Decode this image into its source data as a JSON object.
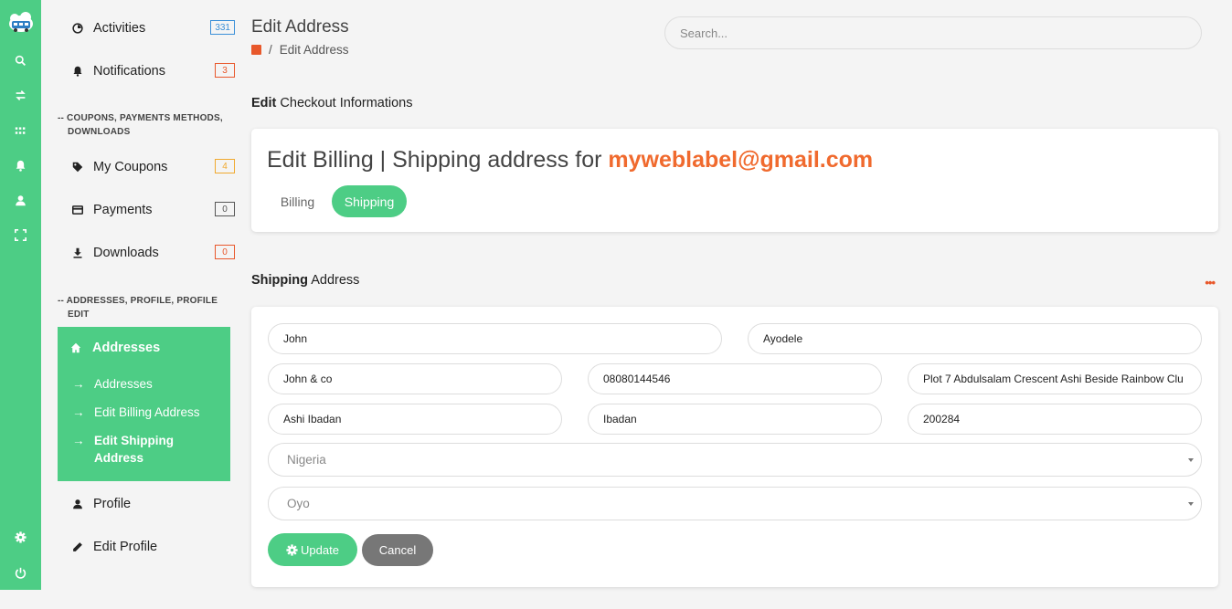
{
  "rail": {
    "icons": [
      "logo-icon",
      "search-icon",
      "swap-icon",
      "grid-icon",
      "bell-icon",
      "user-icon",
      "fullscreen-icon",
      "gear-icon",
      "power-icon"
    ]
  },
  "sidebar": {
    "top_items": [
      {
        "label": "Activities",
        "badge": "331",
        "icon": "activity-icon"
      },
      {
        "label": "Notifications",
        "badge": "3",
        "icon": "bell-icon"
      }
    ],
    "section1": {
      "line1": "-- COUPONS, PAYMENTS METHODS,",
      "line2": "DOWNLOADS"
    },
    "mid_items": [
      {
        "label": "My Coupons",
        "badge": "4",
        "icon": "tag-icon"
      },
      {
        "label": "Payments",
        "badge": "0",
        "icon": "card-icon"
      },
      {
        "label": "Downloads",
        "badge": "0",
        "icon": "download-icon"
      }
    ],
    "section2": {
      "line1": "-- ADDRESSES, PROFILE, PROFILE",
      "line2": "EDIT"
    },
    "active": {
      "label": "Addresses",
      "sub": [
        {
          "label": "Addresses"
        },
        {
          "label": "Edit Billing Address"
        },
        {
          "label": "Edit Shipping",
          "label2": "Address"
        }
      ]
    },
    "bottom_items": [
      {
        "label": "Profile",
        "icon": "user-icon"
      },
      {
        "label": "Edit Profile",
        "icon": "pencil-icon"
      }
    ],
    "arrow": "→"
  },
  "header": {
    "title": "Edit Address",
    "breadcrumb_sep": "/",
    "breadcrumb_current": "Edit Address",
    "search_placeholder": "Search..."
  },
  "checkout": {
    "section_bold": "Edit",
    "section_rest": " Checkout Informations",
    "heading_prefix": "Edit Billing | Shipping address for ",
    "email": "myweblabel@gmail.com",
    "tabs": {
      "billing": "Billing",
      "shipping": "Shipping"
    }
  },
  "shipping": {
    "section_bold": "Shipping",
    "section_rest": " Address",
    "menu_dots": "•••",
    "first_name": "John",
    "last_name": "Ayodele",
    "company": "John & co",
    "phone": "08080144546",
    "address": "Plot 7 Abdulsalam Crescent Ashi Beside Rainbow Clu",
    "address2": "Ashi Ibadan",
    "city": "Ibadan",
    "postcode": "200284",
    "country": "Nigeria",
    "state": "Oyo",
    "update_label": "Update",
    "cancel_label": "Cancel"
  },
  "colors": {
    "accent": "#4dcd85",
    "orange": "#f06a2e",
    "badge_blue": "#3a8fd8",
    "cancel_gray": "#777777"
  }
}
